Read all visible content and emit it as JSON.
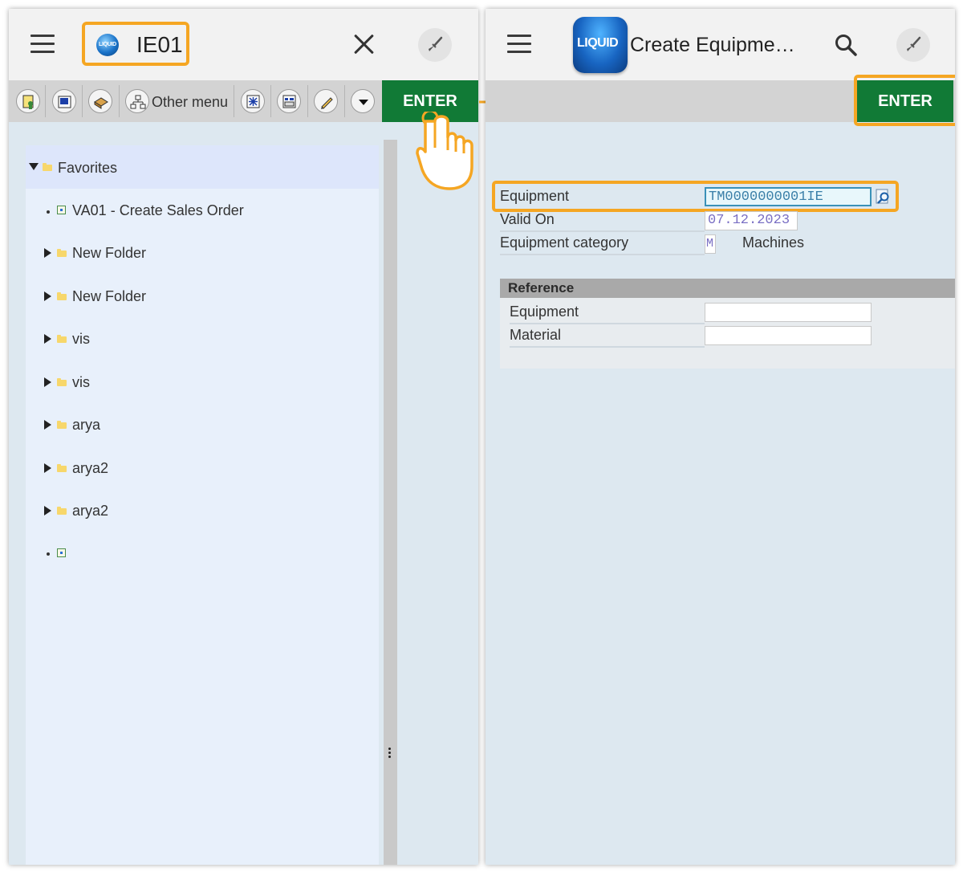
{
  "left_screen": {
    "transaction_code": "IE01",
    "logo_text": "LIQUID",
    "toolbar": {
      "other_menu_label": "Other menu",
      "enter_label": "ENTER"
    },
    "tree": {
      "favorites_label": "Favorites",
      "items": [
        {
          "label": "VA01 - Create Sales Order",
          "kind": "transaction"
        },
        {
          "label": "New Folder",
          "kind": "folder"
        },
        {
          "label": "New Folder",
          "kind": "folder"
        },
        {
          "label": "vis",
          "kind": "folder"
        },
        {
          "label": "vis",
          "kind": "folder"
        },
        {
          "label": "arya",
          "kind": "folder"
        },
        {
          "label": "arya2",
          "kind": "folder"
        },
        {
          "label": "arya2",
          "kind": "folder"
        },
        {
          "label": "",
          "kind": "transaction"
        }
      ]
    }
  },
  "right_screen": {
    "logo_text": "LIQUID",
    "title": "Create Equipme…",
    "enter_label": "ENTER",
    "fields": {
      "equipment_label": "Equipment",
      "equipment_value": "TM0000000001IE",
      "valid_on_label": "Valid On",
      "valid_on_value": "07.12.2023",
      "category_label": "Equipment category",
      "category_value": "M",
      "category_text": "Machines"
    },
    "reference": {
      "title": "Reference",
      "equipment_label": "Equipment",
      "equipment_value": "",
      "material_label": "Material",
      "material_value": ""
    }
  },
  "colors": {
    "highlight": "#f5a623",
    "enter_green": "#117a36",
    "panel_bg": "#dde8f0"
  }
}
